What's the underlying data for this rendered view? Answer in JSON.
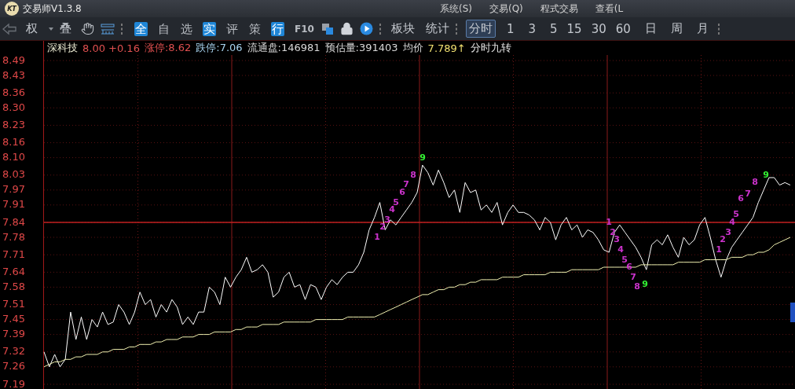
{
  "window": {
    "logo": "KT",
    "title": "交易师V1.3.8",
    "menus": [
      "系统(S)",
      "交易(Q)",
      "程式交易",
      "查看(L"
    ]
  },
  "toolbar": {
    "rights_label": "权",
    "overlay_label": "叠",
    "quick_buttons": [
      {
        "label": "全",
        "highlighted": true
      },
      {
        "label": "自",
        "highlighted": false
      },
      {
        "label": "选",
        "highlighted": false
      },
      {
        "label": "实",
        "highlighted": true
      },
      {
        "label": "评",
        "highlighted": false
      },
      {
        "label": "策",
        "highlighted": false
      },
      {
        "label": "行",
        "highlighted": true
      },
      {
        "label": "F10",
        "highlighted": false
      }
    ],
    "panel_buttons": [
      "板块",
      "统计"
    ],
    "periods": [
      {
        "label": "分时",
        "selected": true
      },
      {
        "label": "1",
        "selected": false
      },
      {
        "label": "3",
        "selected": false
      },
      {
        "label": "5",
        "selected": false
      },
      {
        "label": "15",
        "selected": false
      },
      {
        "label": "30",
        "selected": false
      },
      {
        "label": "60",
        "selected": false
      },
      {
        "label": "日",
        "selected": false
      },
      {
        "label": "周",
        "selected": false
      },
      {
        "label": "月",
        "selected": false
      }
    ]
  },
  "info": [
    {
      "text": "深科技",
      "color": "#e8e8d0"
    },
    {
      "text": "8.00 +0.16",
      "color": "#e05050"
    },
    {
      "text": "涨停:8.62",
      "color": "#e05050"
    },
    {
      "text": "跌停:7.06",
      "color": "#a8d4f0"
    },
    {
      "text": "流通盘:146981",
      "color": "#d8d8d8"
    },
    {
      "text": "预估量:391403",
      "color": "#d8d8d8"
    },
    {
      "text": "均价",
      "color": "#d8d8d8"
    },
    {
      "text": "7.789↑",
      "color": "#f0e070"
    },
    {
      "text": "分时九转",
      "color": "#e8e8e8"
    }
  ],
  "chart_data": {
    "type": "line",
    "ylim": [
      7.19,
      8.49
    ],
    "yticks": [
      {
        "value": 8.49,
        "label": "8.49"
      },
      {
        "value": 8.43,
        "label": "8.43"
      },
      {
        "value": 8.36,
        "label": "8.36"
      },
      {
        "value": 8.3,
        "label": "8.30"
      },
      {
        "value": 8.23,
        "label": "8.23"
      },
      {
        "value": 8.16,
        "label": "8.16"
      },
      {
        "value": 8.1,
        "label": "8.10"
      },
      {
        "value": 8.03,
        "label": "8.03"
      },
      {
        "value": 7.97,
        "label": "7.97"
      },
      {
        "value": 7.91,
        "label": "7.91"
      },
      {
        "value": 7.84,
        "label": "7.84"
      },
      {
        "value": 7.78,
        "label": "7.78"
      },
      {
        "value": 7.71,
        "label": "7.71"
      },
      {
        "value": 7.64,
        "label": "7.64"
      },
      {
        "value": 7.58,
        "label": "7.58"
      },
      {
        "value": 7.51,
        "label": "7.51"
      },
      {
        "value": 7.45,
        "label": "7.45"
      },
      {
        "value": 7.39,
        "label": "7.39"
      },
      {
        "value": 7.32,
        "label": "7.32"
      },
      {
        "value": 7.26,
        "label": "7.26"
      },
      {
        "value": 7.19,
        "label": "7.19"
      }
    ],
    "categories": [
      null,
      null,
      null,
      null,
      null,
      null,
      null,
      null,
      null,
      null,
      null,
      null,
      null,
      null,
      null,
      null,
      null,
      null,
      null,
      null,
      null,
      null,
      null,
      null,
      null,
      null,
      null,
      null,
      null,
      null,
      null,
      null,
      null,
      null,
      null,
      null,
      null,
      null,
      null,
      null,
      null,
      null,
      null,
      null,
      null,
      null,
      null,
      null,
      null,
      null,
      null,
      null,
      null,
      null,
      null,
      null,
      null,
      null,
      null,
      null,
      null,
      null,
      null,
      null,
      null,
      null,
      null,
      null,
      null,
      null,
      null,
      null,
      null,
      null,
      null,
      null,
      null,
      null,
      null,
      null,
      null,
      null,
      null,
      null,
      null,
      null,
      null,
      null,
      null,
      null,
      null,
      null,
      null,
      null,
      null,
      null,
      null,
      null,
      null,
      null,
      null,
      null,
      null,
      null,
      null,
      null,
      null,
      null,
      null,
      null,
      null,
      null,
      null,
      null,
      null,
      null,
      null,
      null,
      null,
      null,
      null,
      null,
      null,
      null,
      null,
      null,
      null,
      null,
      null,
      null,
      null,
      null,
      null,
      null,
      null,
      null,
      null,
      null,
      null,
      null,
      null
    ],
    "series": [
      {
        "color": "#ffffff",
        "values": [
          7.32,
          7.26,
          7.31,
          7.26,
          7.29,
          7.48,
          7.37,
          7.46,
          7.37,
          7.45,
          7.42,
          7.48,
          7.43,
          7.44,
          7.51,
          7.48,
          7.43,
          7.48,
          7.56,
          7.51,
          7.53,
          7.46,
          7.51,
          7.48,
          7.53,
          7.5,
          7.43,
          7.46,
          7.43,
          7.48,
          7.48,
          7.58,
          7.56,
          7.51,
          7.62,
          7.58,
          7.62,
          7.65,
          7.7,
          7.64,
          7.65,
          7.67,
          7.64,
          7.54,
          7.56,
          7.62,
          7.64,
          7.58,
          7.59,
          7.53,
          7.59,
          7.58,
          7.53,
          7.58,
          7.61,
          7.59,
          7.62,
          7.64,
          7.64,
          7.67,
          7.72,
          7.81,
          7.86,
          7.92,
          7.81,
          7.85,
          7.83,
          7.86,
          7.89,
          7.92,
          7.96,
          8.07,
          8.04,
          7.99,
          8.05,
          8.0,
          7.94,
          7.97,
          7.88,
          8.0,
          7.96,
          7.97,
          7.89,
          7.91,
          7.88,
          7.92,
          7.83,
          7.88,
          7.91,
          7.88,
          7.88,
          7.87,
          7.85,
          7.81,
          7.86,
          7.84,
          7.77,
          7.83,
          7.86,
          7.81,
          7.83,
          7.78,
          7.81,
          7.8,
          7.77,
          7.73,
          7.72,
          7.8,
          7.83,
          7.8,
          7.77,
          7.74,
          7.7,
          7.65,
          7.75,
          7.77,
          7.75,
          7.79,
          7.74,
          7.7,
          7.78,
          7.75,
          7.77,
          7.83,
          7.86,
          7.78,
          7.69,
          7.62,
          7.69,
          7.74,
          7.77,
          7.8,
          7.83,
          7.86,
          7.92,
          7.97,
          8.02,
          8.02,
          7.99,
          8.0,
          7.99
        ]
      },
      {
        "color": "#f0f0b0",
        "values": [
          7.26,
          7.27,
          7.28,
          7.28,
          7.29,
          7.29,
          7.3,
          7.3,
          7.31,
          7.31,
          7.31,
          7.32,
          7.32,
          7.33,
          7.33,
          7.33,
          7.34,
          7.34,
          7.35,
          7.35,
          7.35,
          7.36,
          7.36,
          7.37,
          7.37,
          7.37,
          7.38,
          7.38,
          7.38,
          7.39,
          7.39,
          7.39,
          7.4,
          7.4,
          7.4,
          7.4,
          7.41,
          7.41,
          7.42,
          7.42,
          7.42,
          7.43,
          7.43,
          7.43,
          7.43,
          7.44,
          7.44,
          7.44,
          7.44,
          7.44,
          7.44,
          7.45,
          7.45,
          7.45,
          7.45,
          7.45,
          7.45,
          7.46,
          7.46,
          7.46,
          7.46,
          7.46,
          7.46,
          7.47,
          7.48,
          7.49,
          7.5,
          7.51,
          7.52,
          7.53,
          7.54,
          7.55,
          7.55,
          7.56,
          7.57,
          7.57,
          7.58,
          7.58,
          7.59,
          7.59,
          7.6,
          7.6,
          7.61,
          7.61,
          7.61,
          7.61,
          7.62,
          7.62,
          7.62,
          7.62,
          7.63,
          7.63,
          7.63,
          7.63,
          7.63,
          7.64,
          7.64,
          7.64,
          7.64,
          7.65,
          7.65,
          7.65,
          7.65,
          7.65,
          7.65,
          7.66,
          7.66,
          7.66,
          7.66,
          7.66,
          7.66,
          7.66,
          7.67,
          7.67,
          7.67,
          7.67,
          7.67,
          7.67,
          7.67,
          7.68,
          7.68,
          7.68,
          7.68,
          7.68,
          7.69,
          7.69,
          7.69,
          7.69,
          7.69,
          7.7,
          7.7,
          7.7,
          7.71,
          7.71,
          7.72,
          7.72,
          7.73,
          7.75,
          7.76,
          7.77,
          7.78
        ]
      }
    ],
    "grid": true,
    "ref_lines": [
      {
        "axis": "y",
        "value": 7.84
      }
    ],
    "annotations": [
      "1",
      "2",
      "3",
      "4",
      "5",
      "6",
      "7",
      "8",
      "9",
      "1",
      "2",
      "3",
      "4",
      "5",
      "6",
      "7",
      "8",
      "9",
      "1",
      "2",
      "3",
      "4",
      "5",
      "6",
      "7",
      "8",
      "9"
    ]
  },
  "count_labels": [
    {
      "color": "#cc33cc"
    },
    {
      "color": "#cc33cc"
    },
    {
      "color": "#cc33cc"
    },
    {
      "color": "#cc33cc"
    },
    {
      "color": "#cc33cc"
    },
    {
      "color": "#cc33cc"
    },
    {
      "color": "#cc33cc"
    },
    {
      "color": "#cc33cc"
    },
    {
      "color": "#33ee33"
    },
    {
      "color": "#cc33cc"
    },
    {
      "color": "#cc33cc"
    },
    {
      "color": "#cc33cc"
    },
    {
      "color": "#cc33cc"
    },
    {
      "color": "#cc33cc"
    },
    {
      "color": "#cc33cc"
    },
    {
      "color": "#cc33cc"
    },
    {
      "color": "#cc33cc"
    },
    {
      "color": "#33ee33"
    },
    {
      "color": "#cc33cc"
    },
    {
      "color": "#cc33cc"
    },
    {
      "color": "#cc33cc"
    },
    {
      "color": "#cc33cc"
    },
    {
      "color": "#cc33cc"
    },
    {
      "color": "#cc33cc"
    },
    {
      "color": "#cc33cc"
    },
    {
      "color": "#cc33cc"
    },
    {
      "color": "#33ee33"
    }
  ]
}
